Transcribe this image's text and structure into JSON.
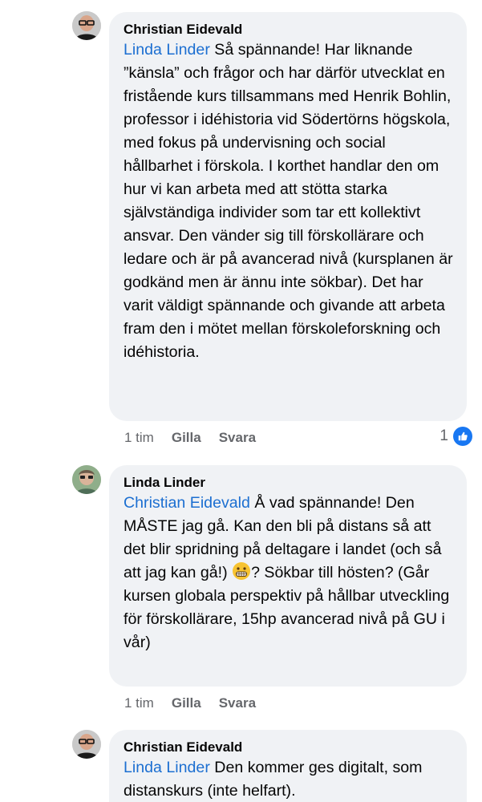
{
  "comments": [
    {
      "author": "Christian Eidevald",
      "mention": "Linda Linder",
      "text": " Så spännande! Har liknande ”känsla” och frågor och har därför utvecklat en fristående kurs tillsammans med Henrik Bohlin, professor i idéhistoria vid Södertörns högskola, med fokus på undervisning och social hållbarhet i förskola. I korthet handlar den om hur vi kan arbeta med att stötta starka självständiga individer som tar ett kollektivt ansvar. Den vänder sig till förskollärare och ledare och är på avancerad nivå (kursplanen är godkänd men är ännu inte sökbar). Det har varit väldigt spännande och givande att arbeta fram den i mötet mellan förskoleforskning och idéhistoria.",
      "time": "1 tim",
      "like_label": "Gilla",
      "reply_label": "Svara",
      "reaction_count": "1"
    },
    {
      "author": "Linda Linder",
      "mention": "Christian Eidevald",
      "text_before_emoji": " Å vad spännande! Den MÅSTE jag gå. Kan den bli på distans så att det blir spridning på deltagare i landet (och så att jag kan gå!) ",
      "emoji": "grimacing-face",
      "text_after_emoji": "? Sökbar till hösten? (Går kursen globala perspektiv på hållbar utveckling för förskollärare, 15hp avancerad nivå på GU i vår)",
      "time": "1 tim",
      "like_label": "Gilla",
      "reply_label": "Svara"
    },
    {
      "author": "Christian Eidevald",
      "mention": "Linda Linder",
      "text": " Den kommer ges digitalt, som distanskurs (inte helfart)."
    }
  ],
  "colors": {
    "bubble": "#f0f2f5",
    "mention": "#1c6fd1",
    "meta": "#65676b",
    "like": "#1877f2"
  }
}
